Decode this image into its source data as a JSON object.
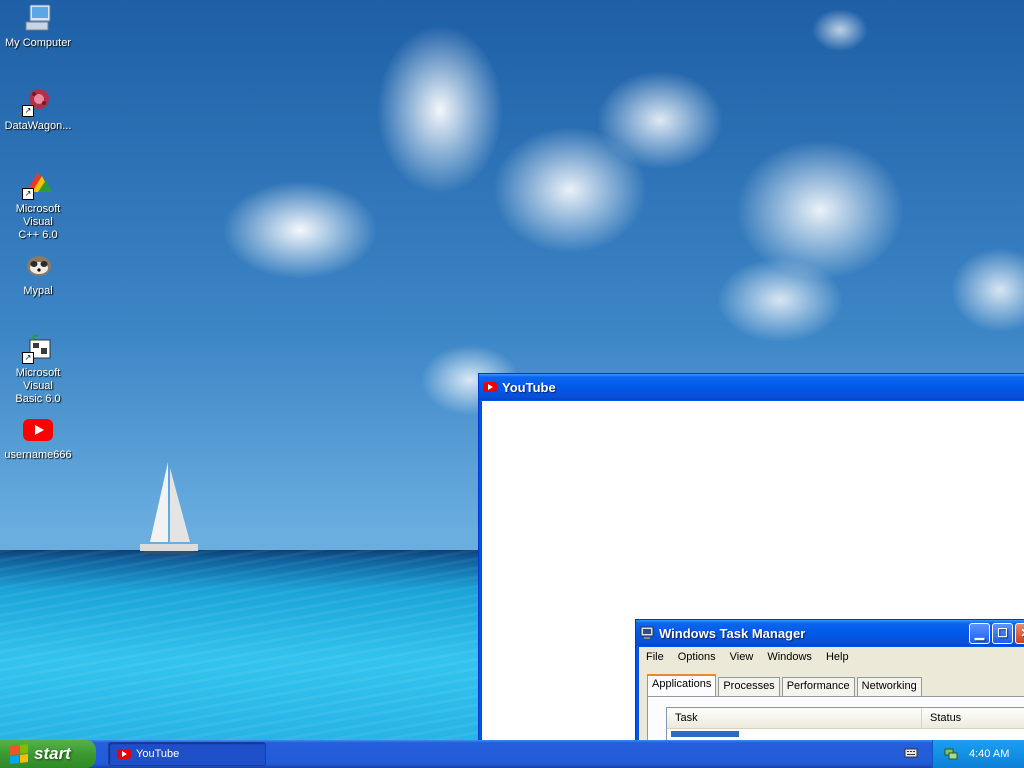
{
  "desktop": {
    "icons": [
      {
        "label": "My Computer",
        "icon": "computer-icon"
      },
      {
        "label": "DataWagon...",
        "icon": "datawagon-icon"
      },
      {
        "label_line1": "Microsoft Visual",
        "label_line2": "C++ 6.0",
        "icon": "visual-cpp-icon"
      },
      {
        "label": "Mypal",
        "icon": "mypal-raccoon-icon"
      },
      {
        "label_line1": "Microsoft Visual",
        "label_line2": "Basic 6.0",
        "icon": "visual-basic-icon"
      },
      {
        "label": "username666",
        "icon": "youtube-icon"
      }
    ]
  },
  "youtube_window": {
    "title": "YouTube",
    "icon": "youtube-icon"
  },
  "task_manager": {
    "title": "Windows Task Manager",
    "menu": [
      "File",
      "Options",
      "View",
      "Windows",
      "Help"
    ],
    "tabs": [
      "Applications",
      "Processes",
      "Performance",
      "Networking"
    ],
    "active_tab": "Applications",
    "columns": [
      "Task",
      "Status"
    ]
  },
  "taskbar": {
    "start_label": "start",
    "items": [
      {
        "label": "YouTube",
        "icon": "youtube-icon"
      }
    ],
    "clock": "4:40 AM"
  },
  "colors": {
    "title_blue": "#0058e6",
    "start_green": "#3c9a31",
    "tray_blue": "#1290e6",
    "youtube_red": "#e00000"
  }
}
